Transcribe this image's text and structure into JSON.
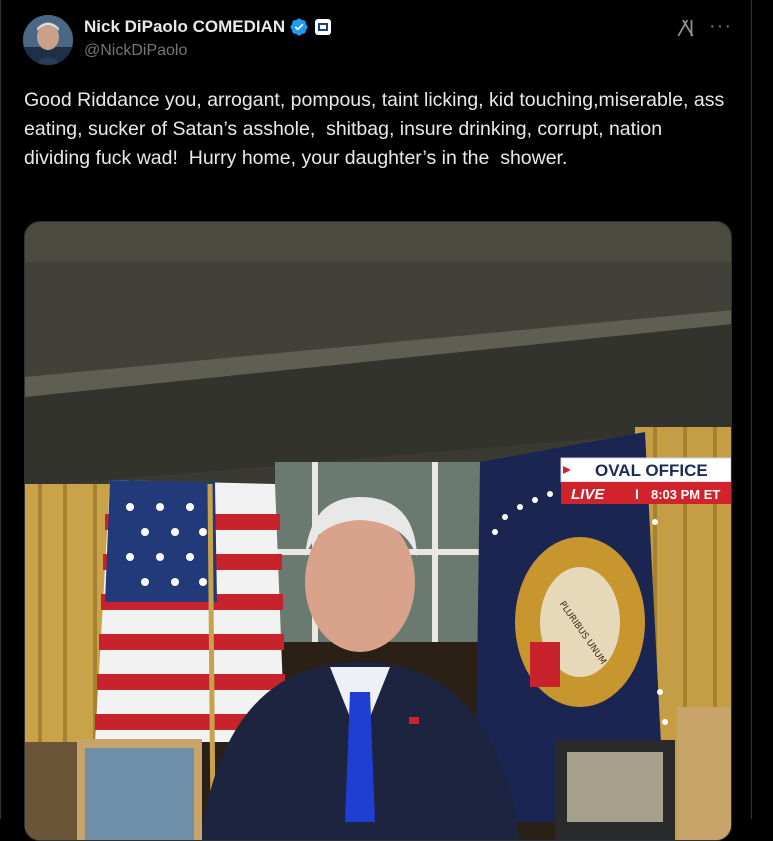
{
  "author": {
    "display_name": "Nick DiPaolo COMEDIAN",
    "handle": "@NickDiPaolo",
    "verified_icon": "verified-badge-icon",
    "affiliate_icon": "affiliate-badge-icon"
  },
  "actions": {
    "grok_icon": "grok-icon",
    "more_icon": "more-options-icon",
    "more_label": "···"
  },
  "tweet": {
    "text": "Good Riddance you, arrogant, pompous, taint licking, kid touching,miserable, ass eating, sucker of Satan’s asshole,  shitbag, insure drinking, corrupt, nation dividing fuck wad!  Hurry home, your daughter’s in the  shower."
  },
  "media": {
    "banner": {
      "title": "OVAL OFFICE",
      "live_label": "LIVE",
      "separator": "I",
      "time": "8:03 PM ET"
    },
    "seal_motto": "PLURIBUS UNUM"
  },
  "colors": {
    "background": "#000000",
    "text": "#e7e9ea",
    "secondary_text": "#71767b",
    "verified_blue": "#1d9bf0",
    "live_red": "#d0232b"
  }
}
